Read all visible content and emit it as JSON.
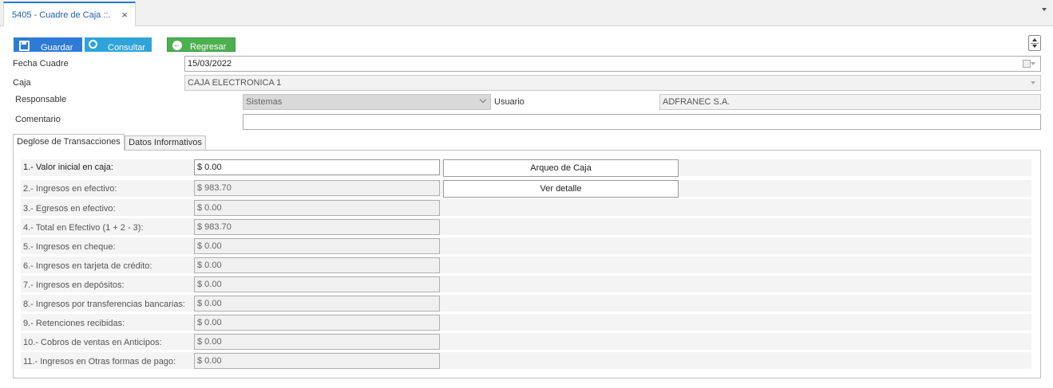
{
  "tab": {
    "title": "5405 - Cuadre de Caja ::.",
    "close_glyph": "×"
  },
  "toolbar": {
    "guardar": "Guardar",
    "consultar": "Consultar",
    "regresar": "Regresar"
  },
  "form": {
    "fecha_label": "Fecha Cuadre",
    "fecha_value": "15/03/2022",
    "caja_label": "Caja",
    "caja_value": "CAJA ELECTRONICA 1",
    "responsable_label": "Responsable",
    "responsable_value": "Sistemas",
    "usuario_label": "Usuario",
    "usuario_value": "ADFRANEC S.A.",
    "comentario_label": "Comentario",
    "comentario_value": ""
  },
  "tabs": [
    {
      "label": "Deglose de Transacciones",
      "active": true
    },
    {
      "label": "Datos Informativos",
      "active": false
    }
  ],
  "rows": [
    {
      "label": "1.- Valor inicial en caja:",
      "value": "$ 0.00"
    },
    {
      "label": "2.- Ingresos en efectivo:",
      "value": "$ 983.70"
    },
    {
      "label": "3.- Egresos en efectivo:",
      "value": "$ 0.00"
    },
    {
      "label": "4.- Total en Efectivo (1 + 2 - 3):",
      "value": "$ 983.70"
    },
    {
      "label": "5.- Ingresos en cheque:",
      "value": "$ 0.00"
    },
    {
      "label": "6.- Ingresos en tarjeta de crédito:",
      "value": "$ 0.00"
    },
    {
      "label": "7.- Ingresos en depósitos:",
      "value": "$ 0.00"
    },
    {
      "label": "8.- Ingresos por transferencias bancarias:",
      "value": "$ 0.00"
    },
    {
      "label": "9.- Retenciones recibidas:",
      "value": "$ 0.00"
    },
    {
      "label": "10.- Cobros de ventas en Anticipos:",
      "value": "$ 0.00"
    },
    {
      "label": "11.- Ingresos en Otras formas de pago:",
      "value": "$ 0.00"
    }
  ],
  "actions": {
    "arqueo": "Arqueo de Caja",
    "ver_detalle": "Ver detalle"
  }
}
